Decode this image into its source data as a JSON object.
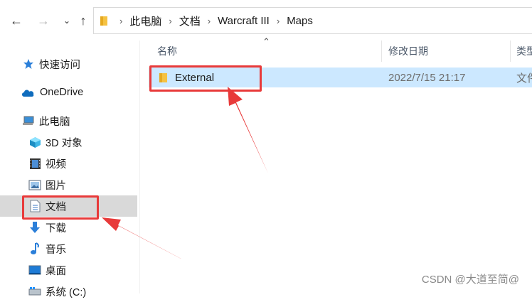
{
  "breadcrumb": [
    "此电脑",
    "文档",
    "Warcraft III",
    "Maps"
  ],
  "sidebar": {
    "items": [
      {
        "label": "快速访问",
        "icon": "star-icon"
      },
      {
        "label": "OneDrive",
        "icon": "cloud-icon"
      },
      {
        "label": "此电脑",
        "icon": "computer-icon"
      },
      {
        "label": "3D 对象",
        "icon": "cube-icon"
      },
      {
        "label": "视频",
        "icon": "film-icon"
      },
      {
        "label": "图片",
        "icon": "picture-icon"
      },
      {
        "label": "文档",
        "icon": "document-icon"
      },
      {
        "label": "下载",
        "icon": "download-icon"
      },
      {
        "label": "音乐",
        "icon": "music-icon"
      },
      {
        "label": "桌面",
        "icon": "desktop-icon"
      },
      {
        "label": "系统 (C:)",
        "icon": "drive-icon"
      }
    ]
  },
  "columns": {
    "name": "名称",
    "modified": "修改日期",
    "type": "类型"
  },
  "files": [
    {
      "name": "External",
      "modified": "2022/7/15 21:17",
      "type": "文件夹"
    }
  ],
  "watermark": "CSDN @大道至简@",
  "colors": {
    "annotation_red": "#e83a3a",
    "selection_blue": "#cce8ff",
    "sidebar_selected": "#d9d9d9"
  }
}
